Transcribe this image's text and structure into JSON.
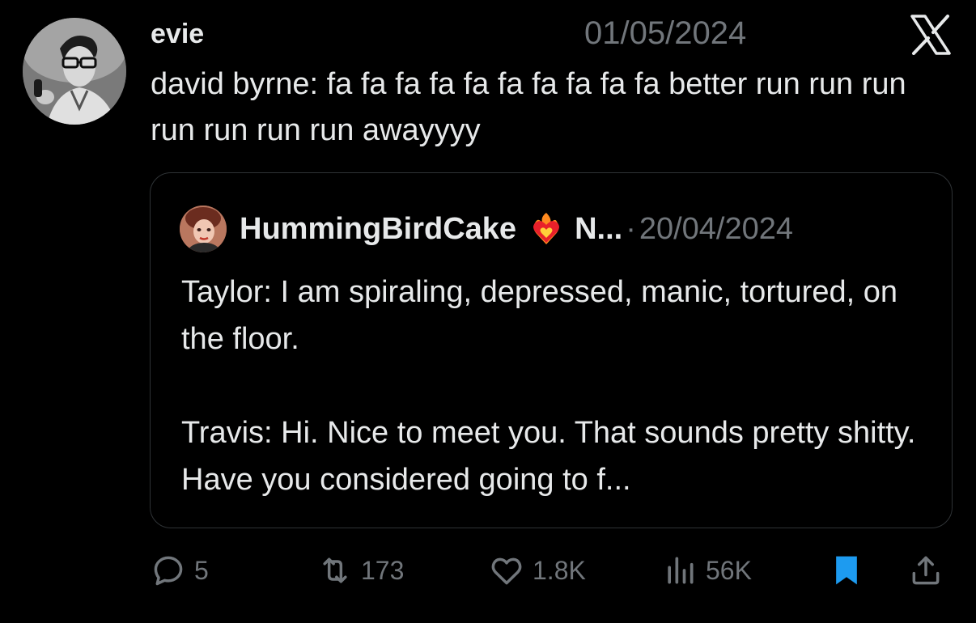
{
  "post": {
    "author_name": "evie",
    "date": "01/05/2024",
    "text": "david byrne: fa fa fa fa fa fa fa fa fa fa better run run run run run run run awayyyy"
  },
  "quote": {
    "author_name": "HummingBirdCake",
    "handle": "N...",
    "separator": "·",
    "date": "20/04/2024",
    "paragraphs": [
      "Taylor: I am spiraling, depressed, manic, tortured, on the floor.",
      "Travis: Hi. Nice to meet you. That sounds pretty shitty. Have you considered going to f..."
    ]
  },
  "actions": {
    "replies": "5",
    "reposts": "173",
    "likes": "1.8K",
    "views": "56K"
  },
  "icons": {
    "brand": "x-logo-icon",
    "reply": "reply-icon",
    "repost": "repost-icon",
    "like": "heart-icon",
    "views": "views-icon",
    "bookmark": "bookmark-icon",
    "share": "share-icon",
    "emoji": "heart-on-fire-icon"
  },
  "colors": {
    "background": "#000000",
    "text": "#e7e9ea",
    "secondary_text": "#71767b",
    "border": "#2f3336",
    "bookmark_active": "#1d9bf0"
  }
}
